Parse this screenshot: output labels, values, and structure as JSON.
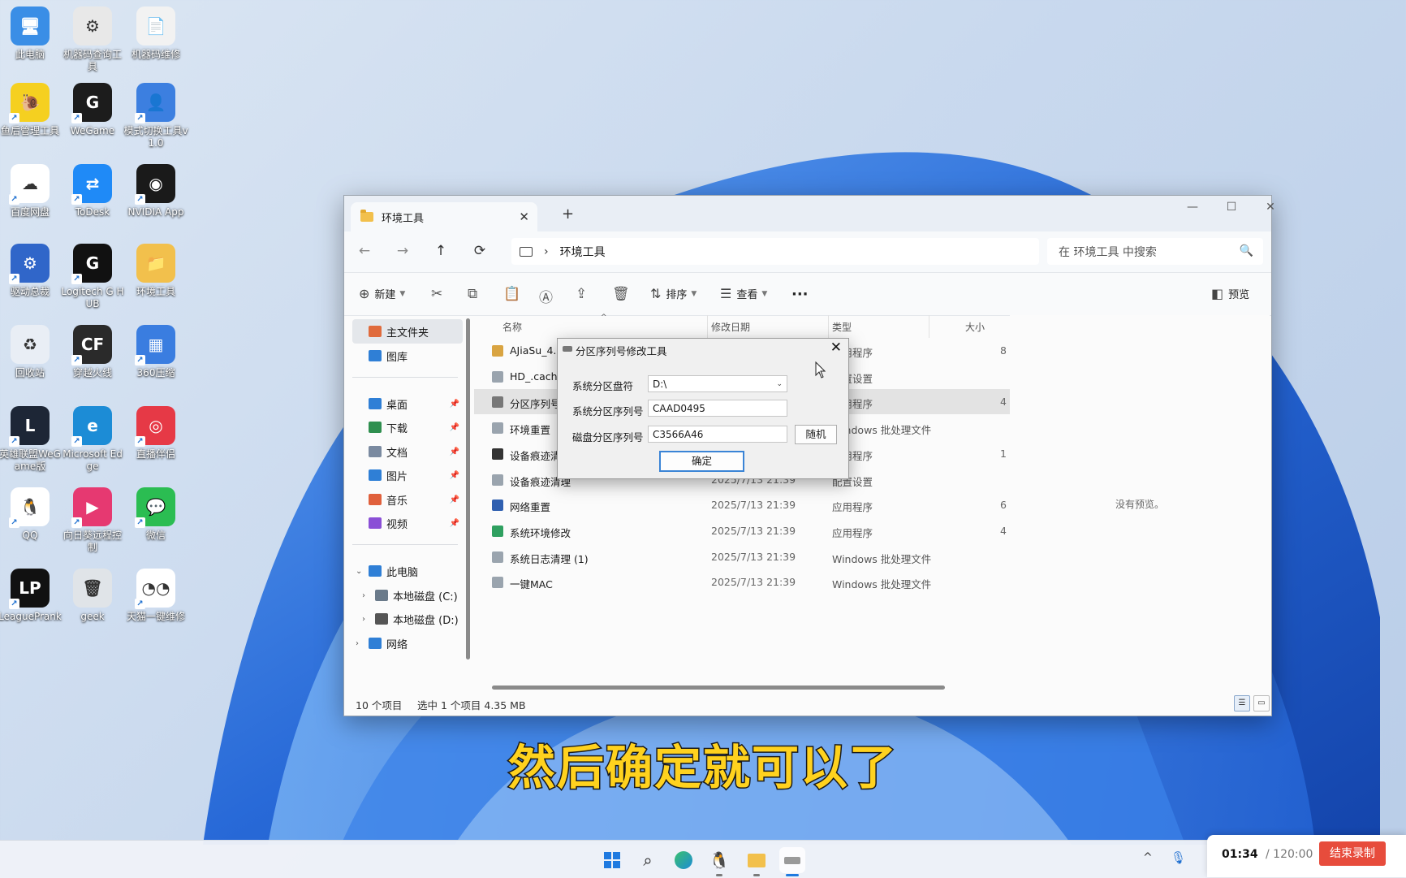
{
  "desktop": {
    "icons": [
      {
        "label": "此电脑",
        "color": "#3a8ee6",
        "glyph": "🖥"
      },
      {
        "label": "机器码查询工具",
        "color": "#e8e8e8",
        "glyph": "⚙"
      },
      {
        "label": "机器码维修",
        "color": "#f2f2f2",
        "glyph": "📄"
      },
      {
        "label": "鱼后管理工具",
        "color": "#f5d020",
        "glyph": "🐌"
      },
      {
        "label": "WeGame",
        "color": "#1c1c1c",
        "glyph": "G"
      },
      {
        "label": "模式切换工具v1.0",
        "color": "#3c7fe0",
        "glyph": "👤"
      },
      {
        "label": "百度网盘",
        "color": "#ffffff",
        "glyph": "☁"
      },
      {
        "label": "ToDesk",
        "color": "#1f8af7",
        "glyph": "⇄"
      },
      {
        "label": "NVIDIA App",
        "color": "#1a1a1a",
        "glyph": "◉"
      },
      {
        "label": "驱动总裁",
        "color": "#3066c9",
        "glyph": "⚙"
      },
      {
        "label": "Logitech G HUB",
        "color": "#111111",
        "glyph": "G"
      },
      {
        "label": "环境工具",
        "color": "#f2c04c",
        "glyph": "📁"
      },
      {
        "label": "回收站",
        "color": "#e9eef5",
        "glyph": "♻"
      },
      {
        "label": "穿越火线",
        "color": "#2a2a2a",
        "glyph": "CF"
      },
      {
        "label": "360压缩",
        "color": "#3a7de0",
        "glyph": "▦"
      },
      {
        "label": "英雄联盟WeGame版",
        "color": "#1d2636",
        "glyph": "L"
      },
      {
        "label": "Microsoft Edge",
        "color": "#1c8cd6",
        "glyph": "e"
      },
      {
        "label": "直播伴侣",
        "color": "#e63946",
        "glyph": "◎"
      },
      {
        "label": "QQ",
        "color": "#ffffff",
        "glyph": "🐧"
      },
      {
        "label": "向日葵远程控制",
        "color": "#e63971",
        "glyph": "▶"
      },
      {
        "label": "微信",
        "color": "#2bbd52",
        "glyph": "💬"
      },
      {
        "label": "LeaguePrank",
        "color": "#111111",
        "glyph": "LP"
      },
      {
        "label": "geek",
        "color": "#e0e4e8",
        "glyph": "🗑"
      },
      {
        "label": "天猫一键维修",
        "color": "#ffffff",
        "glyph": "◔◔"
      }
    ]
  },
  "explorer": {
    "tab_title": "环境工具",
    "tab_close": "✕",
    "new_tab": "+",
    "window_controls": {
      "minimize": "—",
      "maximize": "☐",
      "close": "✕"
    },
    "nav": {
      "back": "←",
      "forward": "→",
      "up": "↑",
      "refresh": "⟳",
      "chevron": "›"
    },
    "address": "环境工具",
    "search_placeholder": "在 环境工具 中搜索",
    "toolbar": {
      "new_label": "新建",
      "sort_label": "排序",
      "view_label": "查看",
      "more": "···",
      "preview_label": "预览"
    },
    "sidebar": [
      {
        "label": "主文件夹",
        "color": "#e06b3c",
        "pinned": false
      },
      {
        "label": "图库",
        "color": "#2f7fd6",
        "pinned": false
      },
      {
        "label": "桌面",
        "color": "#2f7fd6",
        "pinned": true
      },
      {
        "label": "下载",
        "color": "#2f8f4f",
        "pinned": true
      },
      {
        "label": "文档",
        "color": "#7a8aa0",
        "pinned": true
      },
      {
        "label": "图片",
        "color": "#2f7fd6",
        "pinned": true
      },
      {
        "label": "音乐",
        "color": "#e0603c",
        "pinned": true
      },
      {
        "label": "视频",
        "color": "#8a4fd6",
        "pinned": true
      },
      {
        "label": "此电脑",
        "color": "#2f7fd6",
        "pinned": false
      },
      {
        "label": "本地磁盘 (C:)",
        "color": "#6a7a8a",
        "pinned": false
      },
      {
        "label": "本地磁盘 (D:)",
        "color": "#555555",
        "pinned": false
      },
      {
        "label": "网络",
        "color": "#2f7fd6",
        "pinned": false
      }
    ],
    "pin_glyph": "📌",
    "columns": {
      "name": "名称",
      "date": "修改日期",
      "type": "类型",
      "size": "大小"
    },
    "files": [
      {
        "name": "AJiaSu_4.9",
        "date": "",
        "type": "应用程序",
        "size": "8",
        "color": "#d9a441"
      },
      {
        "name": "HD_.cach",
        "date": "",
        "type": "配置设置",
        "size": "",
        "color": "#9aa4ae"
      },
      {
        "name": "分区序列号",
        "date": "",
        "type": "应用程序",
        "size": "4",
        "color": "#777777"
      },
      {
        "name": "环境重置",
        "date": "",
        "type": "Windows 批处理文件",
        "size": "",
        "color": "#9aa4ae"
      },
      {
        "name": "设备痕迹清",
        "date": "",
        "type": "应用程序",
        "size": "1",
        "color": "#333333"
      },
      {
        "name": "设备痕迹清理",
        "date": "2025/7/13 21:39",
        "type": "配置设置",
        "size": "",
        "color": "#9aa4ae"
      },
      {
        "name": "网络重置",
        "date": "2025/7/13 21:39",
        "type": "应用程序",
        "size": "6",
        "color": "#2f5fb0"
      },
      {
        "name": "系统环境修改",
        "date": "2025/7/13 21:39",
        "type": "应用程序",
        "size": "4",
        "color": "#2fa060"
      },
      {
        "name": "系统日志清理 (1)",
        "date": "2025/7/13 21:39",
        "type": "Windows 批处理文件",
        "size": "",
        "color": "#9aa4ae"
      },
      {
        "name": "一键MAC",
        "date": "2025/7/13 21:39",
        "type": "Windows 批处理文件",
        "size": "",
        "color": "#9aa4ae"
      }
    ],
    "no_preview": "没有预览。",
    "status_count": "10 个项目",
    "status_selection": "选中 1 个项目  4.35 MB"
  },
  "dialog": {
    "title": "分区序列号修改工具",
    "close": "✕",
    "drive_label": "系统分区盘符",
    "drive_value": "D:\\",
    "sys_serial_label": "系统分区序列号",
    "sys_serial_value": "CAAD0495",
    "disk_serial_label": "磁盘分区序列号",
    "disk_serial_value": "C3566A46",
    "random_button": "随机",
    "ok_button": "确定"
  },
  "subtitle": "然后确定就可以了",
  "taskbar": {
    "tray_chevron": "^",
    "recorder_time": "01:34",
    "recorder_total": "/ 120:00",
    "recorder_stop": "结束录制"
  }
}
